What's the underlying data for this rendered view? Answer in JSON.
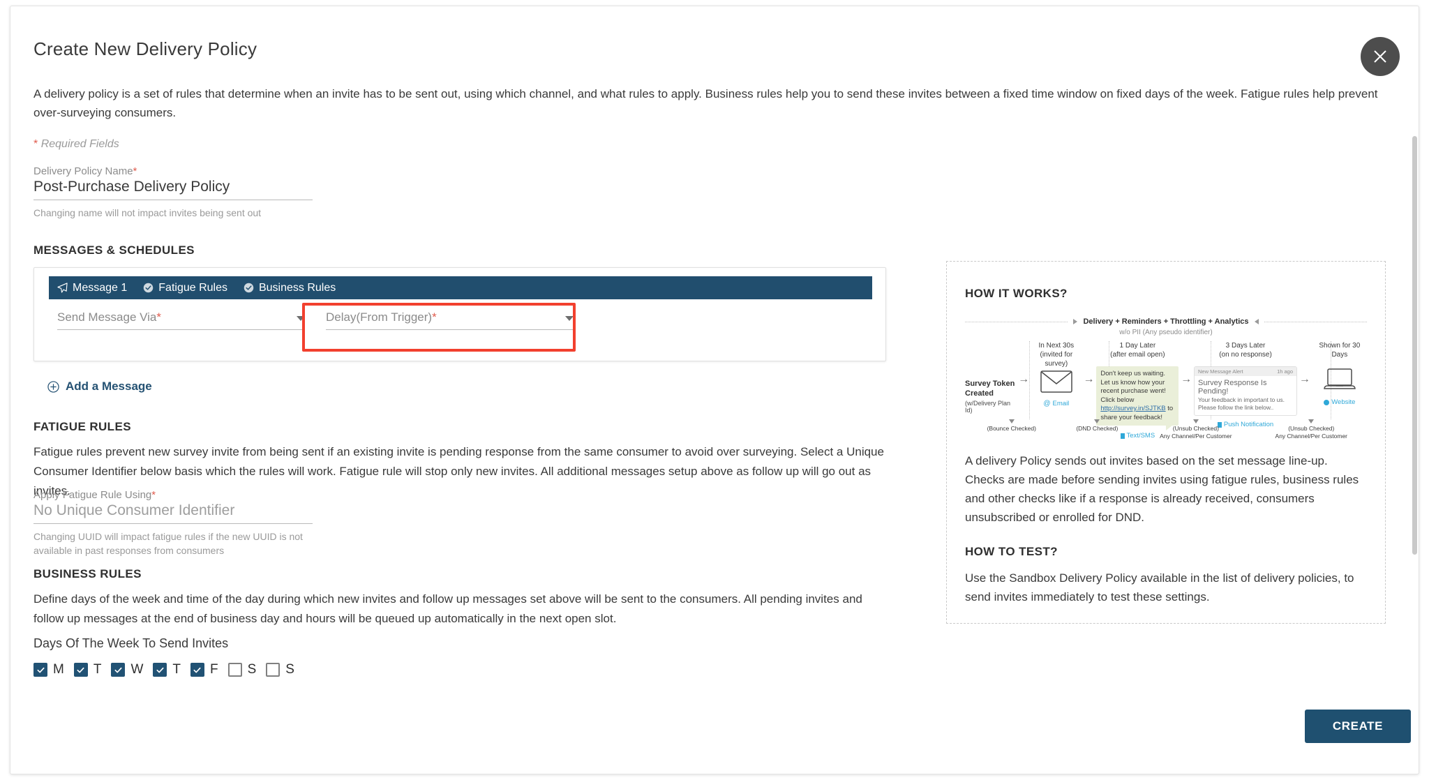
{
  "dialog": {
    "title": "Create New Delivery Policy",
    "close_icon": "close-icon",
    "intro": "A delivery policy is a set of rules that determine when an invite has to be sent out, using which channel, and what rules to apply. Business rules help you to send these invites between a fixed time window on fixed days of the week. Fatigue rules help prevent over-surveying consumers.",
    "required_star": "*",
    "required_fields_note": "Required Fields",
    "create_label": "CREATE"
  },
  "policy_name": {
    "label": "Delivery Policy Name",
    "required_star": "*",
    "value": "Post-Purchase Delivery Policy",
    "hint": "Changing name will not impact invites being sent out"
  },
  "messages_section": {
    "heading": "MESSAGES & SCHEDULES",
    "tabs": [
      {
        "label": "Message 1",
        "icon": "paper-plane-icon"
      },
      {
        "label": "Fatigue Rules",
        "icon": "check-circle-icon"
      },
      {
        "label": "Business Rules",
        "icon": "check-circle-icon"
      }
    ],
    "send_via": {
      "label": "Send Message Via",
      "required_star": "*",
      "value": ""
    },
    "delay": {
      "label": "Delay(From Trigger)",
      "required_star": "*",
      "value": "",
      "highlighted": true,
      "highlight_color": "#f2402e"
    },
    "add_message_label": "Add a Message"
  },
  "fatigue_section": {
    "heading": "FATIGUE RULES",
    "body": "Fatigue rules prevent new survey invite from being sent if an existing invite is pending response from the same consumer to avoid over surveying. Select a Unique Consumer Identifier below basis which the rules will work. Fatigue rule will stop only new invites. All additional messages setup above as follow up will go out as invites.",
    "field": {
      "label": "Apply Fatigue Rule Using",
      "required_star": "*",
      "value": "No Unique Consumer Identifier",
      "hint": "Changing UUID will impact fatigue rules if the new UUID is not available in past responses from consumers"
    }
  },
  "business_section": {
    "heading": "BUSINESS RULES",
    "body": "Define days of the week and time of the day during which new invites and follow up messages set above will be sent to the consumers. All pending invites and follow up messages at the end of business day and hours will be queued up automatically in the next open slot.",
    "days_label": "Days Of The Week To Send Invites",
    "days": [
      {
        "letter": "M",
        "checked": true
      },
      {
        "letter": "T",
        "checked": true
      },
      {
        "letter": "W",
        "checked": true
      },
      {
        "letter": "T",
        "checked": true
      },
      {
        "letter": "F",
        "checked": true
      },
      {
        "letter": "S",
        "checked": false
      },
      {
        "letter": "S",
        "checked": false
      }
    ],
    "checked_color": "#215274"
  },
  "info_panel": {
    "how_it_works_heading": "HOW IT WORKS?",
    "how_it_works_body": "A delivery Policy sends out invites based on the set message line-up. Checks are made before sending invites using fatigue rules, business rules and other checks like if a response is already received, consumers unsubscribed or enrolled for DND.",
    "how_to_test_heading": "HOW TO TEST?",
    "how_to_test_body": "Use the Sandbox Delivery Policy available in the list of delivery policies, to send invites immediately to test these settings.",
    "diagram": {
      "banner": "Delivery + Reminders + Throttling + Analytics",
      "banner_sub": "w/o PII (Any pseudo identifier)",
      "token_title": "Survey Token Created",
      "token_sub": "(w/Delivery Plan Id)",
      "steps": [
        {
          "caption_line1": "In Next 30s",
          "caption_line2": "(invited for survey)",
          "channel": "Email",
          "check": "(Bounce Checked)"
        },
        {
          "caption_line1": "1 Day Later",
          "caption_line2": "(after email open)",
          "channel": "Text/SMS",
          "check": "(DND Checked)"
        },
        {
          "caption_line1": "3 Days Later",
          "caption_line2": "(on no response)",
          "channel": "Push Notification",
          "check": "(Unsub Checked)",
          "check_line2": "Any Channel/Per Customer"
        },
        {
          "caption_line1": "Shown for 30 Days",
          "caption_line2": "",
          "channel": "Website",
          "check": "(Unsub Checked)",
          "check_line2": "Any Channel/Per Customer"
        }
      ],
      "sms_text_a": "Don't keep us waiting. Let us know how your recent purchase went! Click below ",
      "sms_link": "http://survey.in/SJTKB",
      "sms_text_b": " to share your feedback!",
      "push_header_left": "New Message Alert",
      "push_header_right": "1h ago",
      "push_title": "Survey Response Is Pending!",
      "push_body": "Your feedback in important to us. Please follow the link below.."
    }
  }
}
